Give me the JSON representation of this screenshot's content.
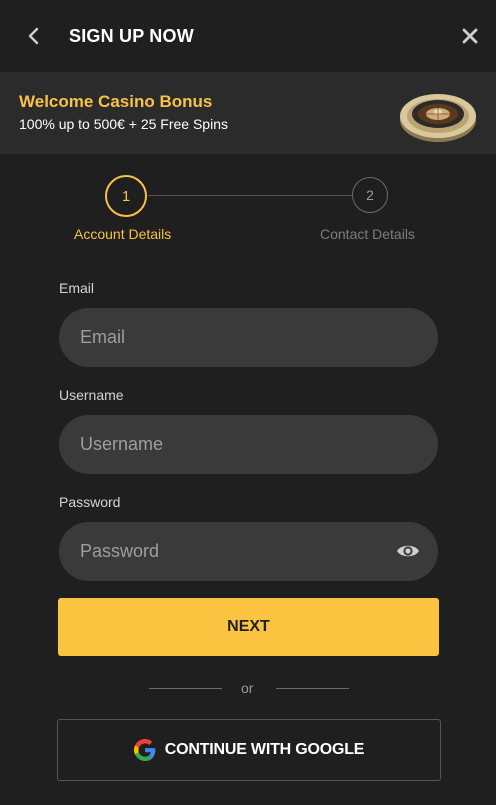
{
  "header": {
    "title": "SIGN UP NOW",
    "back_icon": "chevron-left-icon",
    "close_icon": "close-icon"
  },
  "banner": {
    "title": "Welcome Casino Bonus",
    "subtitle": "100% up to 500€ + 25 Free Spins",
    "image": "roulette-wheel"
  },
  "stepper": {
    "current_step": 1,
    "steps": [
      {
        "number": "1",
        "label": "Account Details"
      },
      {
        "number": "2",
        "label": "Contact Details"
      }
    ]
  },
  "form": {
    "email": {
      "label": "Email",
      "placeholder": "Email",
      "value": ""
    },
    "username": {
      "label": "Username",
      "placeholder": "Username",
      "value": ""
    },
    "password": {
      "label": "Password",
      "placeholder": "Password",
      "value": "",
      "toggle_icon": "eye-icon"
    }
  },
  "actions": {
    "next_label": "NEXT",
    "divider_text": "or",
    "google_label": "CONTINUE WITH GOOGLE",
    "google_icon": "google-icon"
  },
  "colors": {
    "accent": "#fbc440",
    "background": "#1f1f1f",
    "banner_bg": "#2b2b2b",
    "input_bg": "#3a3a3a"
  }
}
